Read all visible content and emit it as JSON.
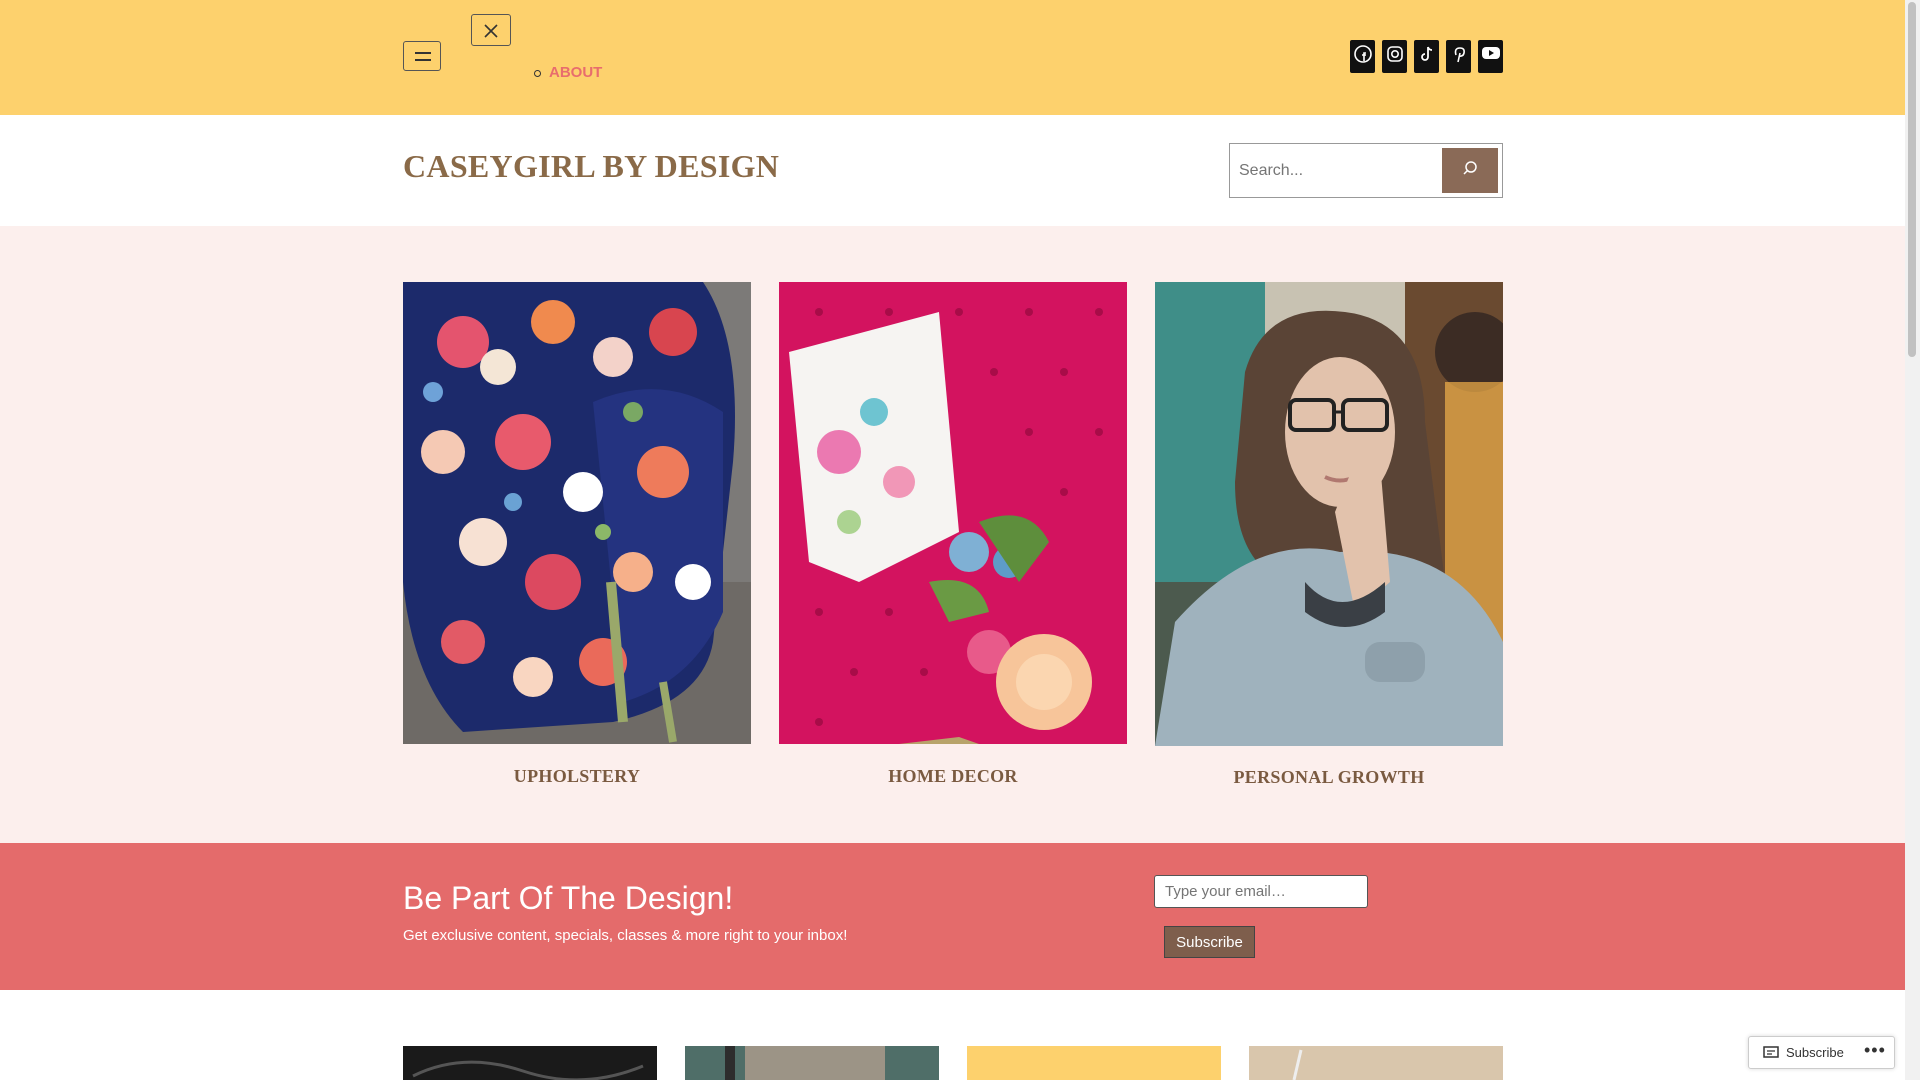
{
  "nav": {
    "menu_item": "ABOUT",
    "open_menu_label": "Open menu",
    "close_menu_label": "Close menu"
  },
  "social": [
    {
      "name": "facebook-icon"
    },
    {
      "name": "instagram-icon"
    },
    {
      "name": "tiktok-icon"
    },
    {
      "name": "pinterest-icon"
    },
    {
      "name": "youtube-icon"
    }
  ],
  "header": {
    "site_title": "CASEYGIRL BY DESIGN",
    "search_placeholder": "Search..."
  },
  "features": [
    {
      "label": "UPHOLSTERY"
    },
    {
      "label": "HOME DECOR"
    },
    {
      "label": "PERSONAL GROWTH"
    }
  ],
  "signup": {
    "title": "Be Part Of The Design!",
    "subtitle": "Get exclusive content, specials, classes & more right to your inbox!",
    "email_placeholder": "Type your email…",
    "button": "Subscribe"
  },
  "floating": {
    "subscribe_label": "Subscribe"
  },
  "colors": {
    "topbar": "#fdd16d",
    "accent": "#e46b6b",
    "brown": "#8a6a48"
  }
}
